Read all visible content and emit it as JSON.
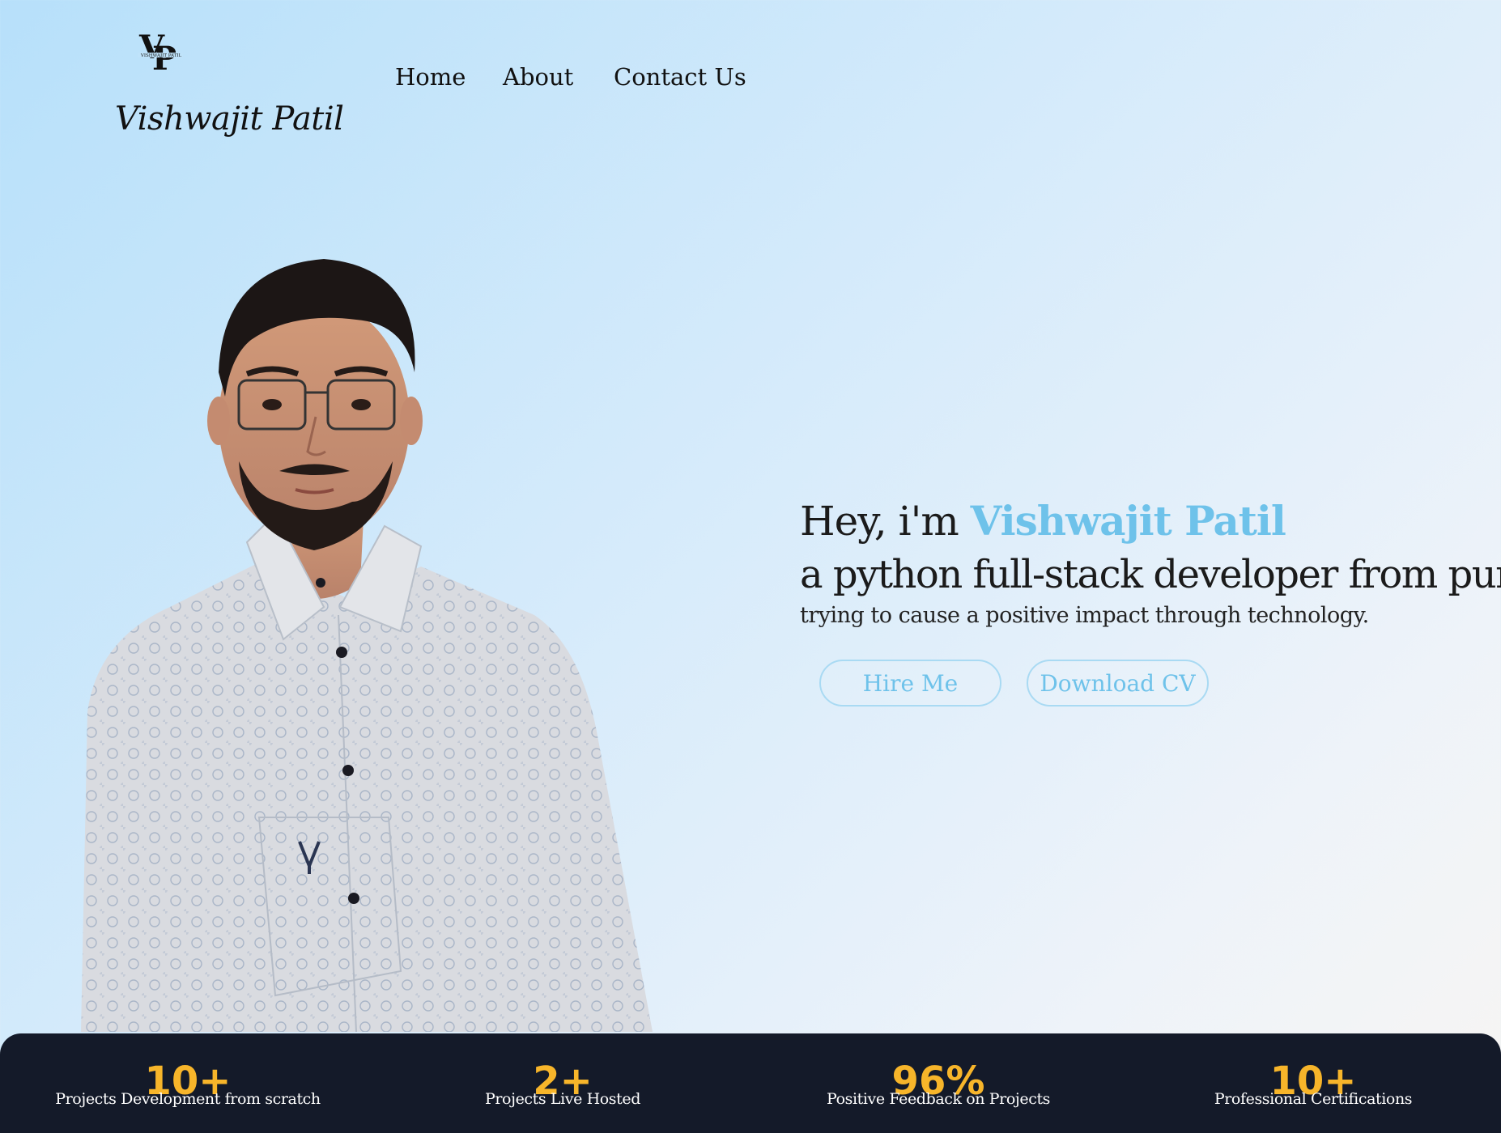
{
  "header": {
    "logo": {
      "icon": "vp-monogram-logo",
      "monogram": "VP",
      "caption": "VISHWAJIT PATIL"
    },
    "brand_name": "Vishwajit Patil",
    "nav": [
      {
        "label": "Home"
      },
      {
        "label": "About"
      },
      {
        "label": "Contact Us"
      }
    ]
  },
  "hero": {
    "greeting": "Hey, i'm",
    "name": "Vishwajit Patil",
    "headline": "a python full-stack developer from pune",
    "tagline": "trying to cause a positive impact through technology.",
    "buttons": {
      "hire": "Hire Me",
      "download_cv": "Download CV"
    },
    "portrait_alt": "portrait-photo"
  },
  "stats": [
    {
      "value": "10+",
      "label": "Projects Development from scratch"
    },
    {
      "value": "2+",
      "label": "Projects Live Hosted"
    },
    {
      "value": "96%",
      "label": "Positive Feedback on Projects"
    },
    {
      "value": "10+",
      "label": "Professional Certifications"
    }
  ],
  "colors": {
    "accent_blue": "#6ec2ea",
    "stat_gold": "#f7b52a",
    "stats_bg": "#141a29"
  }
}
